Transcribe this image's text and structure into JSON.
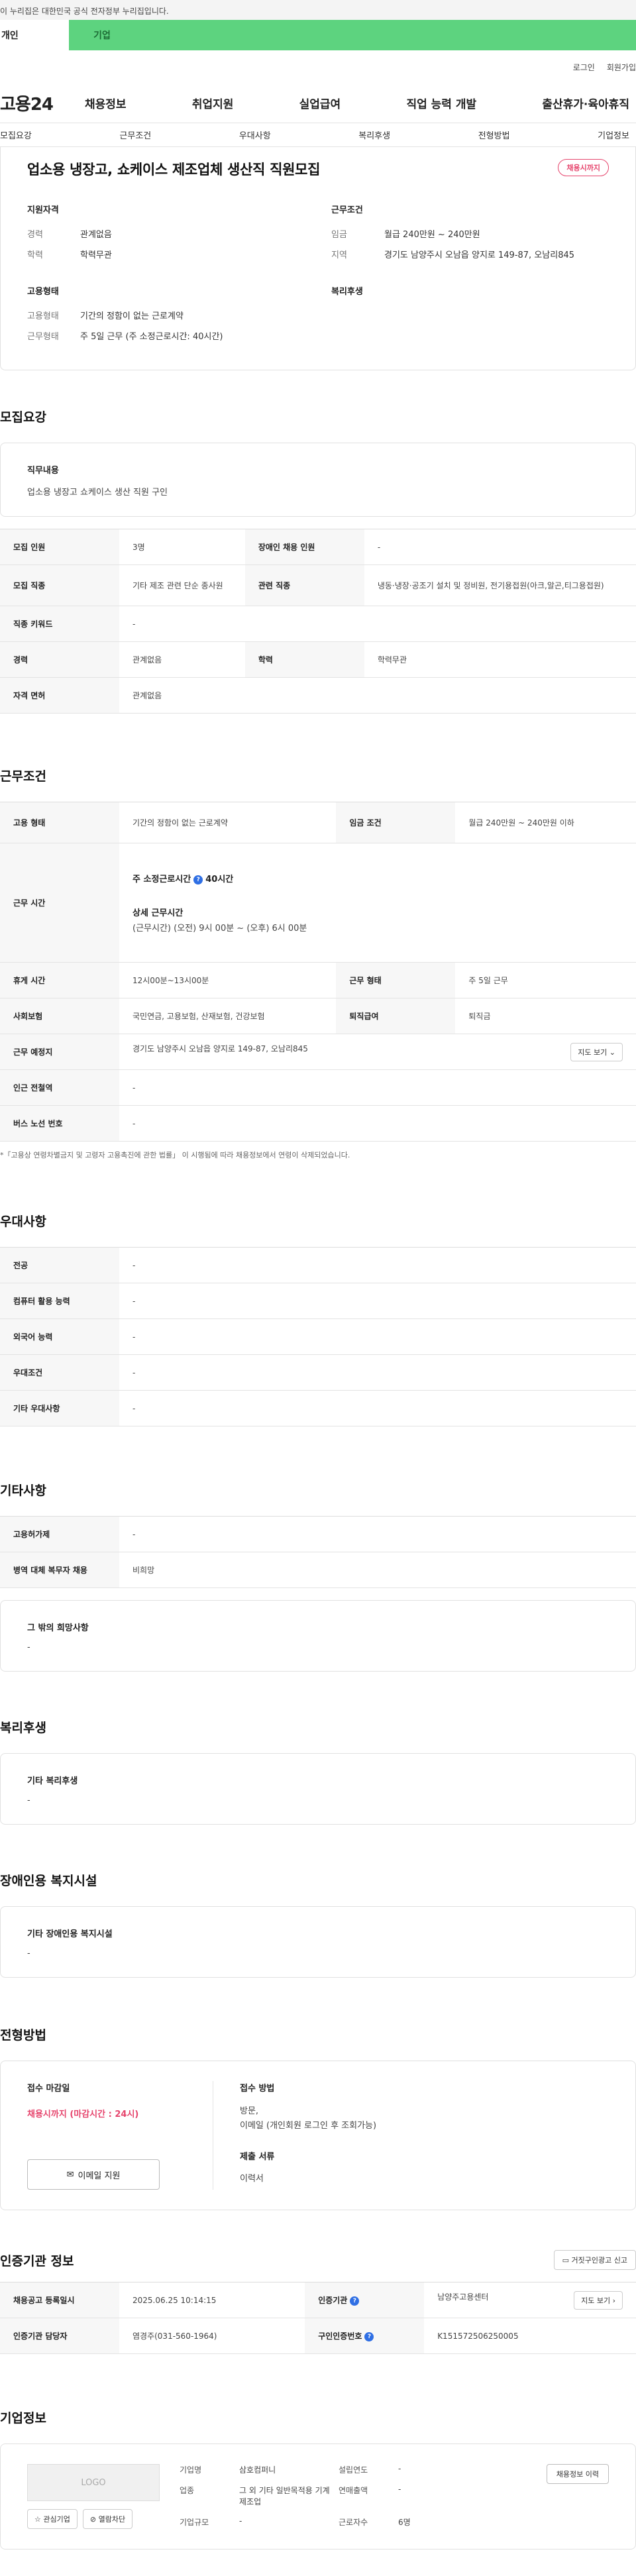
{
  "gov_banner": "이 누리집은 대한민국 공식 전자정부 누리집입니다.",
  "user_tabs": [
    "개인",
    "기업"
  ],
  "util": [
    "로그인",
    "회원가입"
  ],
  "logo": "고용24",
  "gnb": [
    "채용정보",
    "취업지원",
    "실업급여",
    "직업 능력 개발",
    "출산휴가·육아휴직"
  ],
  "subnav": [
    "모집요강",
    "근무조건",
    "우대사항",
    "복리후생",
    "전형방법",
    "기업정보"
  ],
  "summary": {
    "title": "업소용 냉장고, 쇼케이스 제조업체 생산직 직원모집",
    "status": "채용시까지",
    "qual_title": "지원자격",
    "career_k": "경력",
    "career_v": "관계없음",
    "edu_k": "학력",
    "edu_v": "학력무관",
    "cond_title": "근무조건",
    "wage_k": "임금",
    "wage_v": "월급 240만원 ~ 240만원",
    "region_k": "지역",
    "region_v": "경기도 남양주시 오남읍 양지로 149-87, 오남리845",
    "emp_title": "고용형태",
    "emptype_k": "고용형태",
    "emptype_v": "기간의 정함이 없는 근로계약",
    "workform_k": "근무형태",
    "workform_v": "주 5일 근무 (주 소정근로시간: 40시간)",
    "welfare_title": "복리후생"
  },
  "recruit": {
    "section_title": "모집요강",
    "job_title": "직무내용",
    "job_text": "업소용 냉장고 쇼케이스 생산 직원 구인",
    "rows": {
      "count_k": "모집 인원",
      "count_v": "3명",
      "disabled_k": "장애인 채용 인원",
      "disabled_v": "-",
      "jobtype_k": "모집 직종",
      "jobtype_v": "기타 제조 관련 단순 종사원",
      "related_k": "관련 직종",
      "related_v": "냉동·냉장·공조기 설치 및 정비원, 전기용접원(아크,알곤,티그용접원)",
      "keyword_k": "직종 키워드",
      "keyword_v": "-",
      "career_k": "경력",
      "career_v": "관계없음",
      "edu_k": "학력",
      "edu_v": "학력무관",
      "license_k": "자격 면허",
      "license_v": "관계없음"
    }
  },
  "conditions": {
    "section_title": "근무조건",
    "emptype_k": "고용 형태",
    "emptype_v": "기간의 정함이 없는 근로계약",
    "wage_k": "임금 조건",
    "wage_v": "월급 240만원 ~ 240만원 이하",
    "hours_k": "근무 시간",
    "hours_weekly_label": "주 소정근로시간",
    "hours_weekly_value": "40시간",
    "hours_detail_label": "상세 근무시간",
    "hours_detail_value": "(근무시간) (오전) 9시 00분 ~ (오후) 6시 00분",
    "break_k": "휴게 시간",
    "break_v": "12시00분~13시00분",
    "form_k": "근무 형태",
    "form_v": "주 5일 근무",
    "insurance_k": "사회보험",
    "insurance_v": "국민연금, 고용보험, 산재보험, 건강보험",
    "severance_k": "퇴직급여",
    "severance_v": "퇴직금",
    "place_k": "근무 예정지",
    "place_v": "경기도 남양주시 오남읍 양지로 149-87, 오남리845",
    "map_btn": "지도 보기",
    "subway_k": "인근 전철역",
    "subway_v": "-",
    "bus_k": "버스 노선 번호",
    "bus_v": "-",
    "note": "*「고용상 연령차별금지 및 고령자 고용촉진에 관한 법률」 이 시행됨에 따라 채용정보에서 연령이 삭제되었습니다."
  },
  "preference": {
    "section_title": "우대사항",
    "major_k": "전공",
    "major_v": "-",
    "computer_k": "컴퓨터 활용 능력",
    "computer_v": "-",
    "lang_k": "외국어 능력",
    "lang_v": "-",
    "pref_k": "우대조건",
    "pref_v": "-",
    "other_k": "기타 우대사항",
    "other_v": "-"
  },
  "other": {
    "section_title": "기타사항",
    "license_k": "고용허가제",
    "license_v": "-",
    "military_k": "병역 대체 복무자 채용",
    "military_v": "비희망",
    "wish_title": "그 밖의 희망사항",
    "wish_v": "-"
  },
  "welfare": {
    "section_title": "복리후생",
    "box_title": "기타 복리후생",
    "box_v": "-"
  },
  "disabled": {
    "section_title": "장애인용 복지시설",
    "box_title": "기타 장애인용 복지시설",
    "box_v": "-"
  },
  "selection": {
    "section_title": "전형방법",
    "deadline_title": "접수 마감일",
    "deadline_v": "채용시까지 (마감시간 : 24시)",
    "email_btn": "이메일 지원",
    "method_title": "접수 방법",
    "method_line1": "방문,",
    "method_line2": "이메일 (개인회원 로그인 후 조회가능)",
    "docs_title": "제출 서류",
    "docs_v": "이력서"
  },
  "agency": {
    "section_title": "인증기관 정보",
    "report_btn": "거짓구인광고 신고",
    "regdate_k": "채용공고 등록일시",
    "regdate_v": "2025.06.25 10:14:15",
    "agency_k": "인증기관",
    "agency_v": "남양주고용센터",
    "map_btn": "지도 보기",
    "manager_k": "인증기관 담당자",
    "manager_v": "염경주(031-560-1964)",
    "reqno_k": "구인인증번호",
    "reqno_v": "K151572506250005"
  },
  "company": {
    "section_title": "기업정보",
    "logo": "LOGO",
    "fav_btn": "관심기업",
    "block_btn": "열람차단",
    "name_k": "기업명",
    "name_v": "삼호컴퍼니",
    "industry_k": "업종",
    "industry_v": "그 외 기타 일반목적용 기계 제조업",
    "size_k": "기업규모",
    "size_v": "-",
    "est_k": "설립연도",
    "est_v": "-",
    "sales_k": "연매출액",
    "sales_v": "-",
    "emp_k": "근로자수",
    "emp_v": "6명",
    "info_btn": "채용정보 이력"
  }
}
